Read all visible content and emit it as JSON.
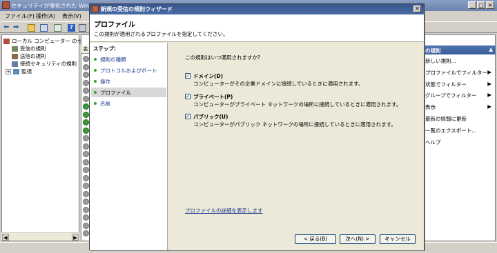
{
  "main_window": {
    "title": "セキュリティが強化された Windo",
    "menu": [
      "ファイル(F)",
      "操作(A)",
      "表示(V)"
    ],
    "tree": {
      "root": "ローカル コンピューター のセキ",
      "items": [
        "受信の規則",
        "送信の規則",
        "接続セキュリティの規則",
        "監視"
      ],
      "expander": "+"
    },
    "list_header": "名",
    "right_pane": {
      "header": "の規則",
      "collapse": "▲",
      "actions": [
        {
          "label": "新しい規則...",
          "submenu": false
        },
        {
          "label": "プロファイルでフィルター",
          "submenu": true
        },
        {
          "label": "状態でフィルター",
          "submenu": true
        },
        {
          "label": "グループでフィルター",
          "submenu": true
        },
        {
          "label": "表示",
          "submenu": true
        },
        {
          "label": "最新の情報に更新",
          "submenu": false
        },
        {
          "label": "一覧のエクスポート...",
          "submenu": false
        },
        {
          "label": "ヘルプ",
          "submenu": false
        }
      ]
    }
  },
  "wizard": {
    "title": "新規の受信の規則ウィザード",
    "close_glyph": "✕",
    "page_title": "プロファイル",
    "page_subtitle": "この規則が適用されるプロファイルを指定してください。",
    "steps_title": "ステップ:",
    "steps": [
      "規則の種類",
      "プロトコルおよびポート",
      "操作",
      "プロファイル",
      "名前"
    ],
    "active_step": 3,
    "question": "この規則はいつ適用されますか?",
    "options": [
      {
        "label": "ドメイン(D)",
        "desc": "コンピューターがその企業ドメインに接続しているときに適用されます。",
        "checked": true
      },
      {
        "label": "プライベート(P)",
        "desc": "コンピューターがプライベート ネットワークの場所に接続しているときに適用されます。",
        "checked": true
      },
      {
        "label": "パブリック(U)",
        "desc": "コンピューターがパブリック ネットワークの場所に接続しているときに適用されます。",
        "checked": true
      }
    ],
    "check_glyph": "✓",
    "detail_link": "プロファイルの詳細を表示します",
    "buttons": {
      "back": "< 戻る(B)",
      "next": "次へ(N) >",
      "cancel": "キャンセル"
    }
  },
  "colors": {
    "titlebar": "#36558c",
    "link": "#1a3a8f",
    "check_green": "#3a9a3a"
  }
}
